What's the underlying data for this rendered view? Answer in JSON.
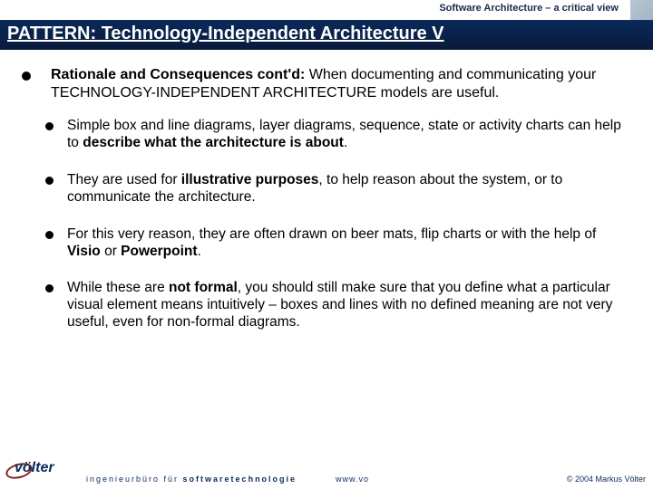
{
  "header": {
    "doc_title": "Software Architecture – a critical view",
    "slide_title": "PATTERN: Technology-Independent Architecture V"
  },
  "main": {
    "lead_bold": "Rationale and Consequences cont'd:",
    "lead_rest": " When documenting and communicating your TECHNOLOGY-INDEPENDENT ARCHITECTURE models are useful.",
    "b1_a": "Simple box and line diagrams, layer diagrams, sequence, state or activity charts can help to ",
    "b1_bold": "describe what the architecture is about",
    "b1_c": ".",
    "b2_a": "They are used for ",
    "b2_bold": "illustrative purposes",
    "b2_c": ", to help reason about the system, or to communicate the architecture.",
    "b3_a": "For this very reason, they are often drawn on beer mats, flip charts or with the help of ",
    "b3_bold1": "Visio",
    "b3_mid": " or ",
    "b3_bold2": "Powerpoint",
    "b3_c": ".",
    "b4_a": "While these are ",
    "b4_bold": "not formal",
    "b4_c": ", you should still make sure that you define what a particular visual element means intuitively – boxes and lines with no defined meaning are not very useful, even for non-formal diagrams."
  },
  "footer": {
    "logo": "völter",
    "tagline_a": "ingenieurbüro für ",
    "tagline_b": "softwaretechnologie",
    "url": "www.vo",
    "copyright": "© 2004 Markus Völter"
  }
}
